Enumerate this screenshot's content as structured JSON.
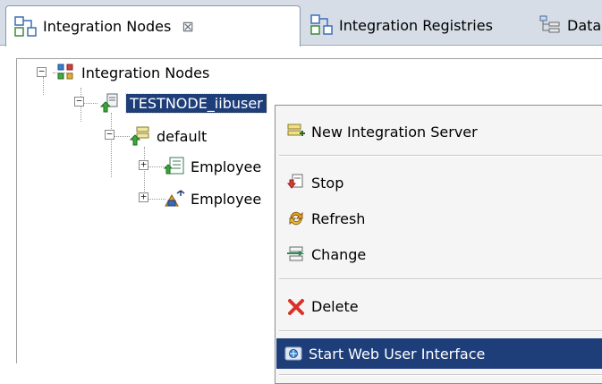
{
  "tabs": [
    {
      "label": "Integration Nodes",
      "close": "⊠",
      "icon": "integration-nodes-icon"
    },
    {
      "label": "Integration Registries",
      "icon": "integration-registries-icon"
    },
    {
      "label": "Data",
      "icon": "data-icon"
    }
  ],
  "tree": {
    "root": {
      "label": "Integration Nodes",
      "expander": "−"
    },
    "node": {
      "label": "TESTNODE_iibuser",
      "expander": "−"
    },
    "server": {
      "label": "default",
      "expander": "−"
    },
    "children": [
      {
        "label": "Employee",
        "expander": "+"
      },
      {
        "label": "Employee",
        "expander": "+"
      }
    ]
  },
  "context_menu": {
    "items": [
      {
        "label": "New Integration Server",
        "icon": "new-server-icon"
      },
      {
        "label": "Stop",
        "icon": "stop-icon"
      },
      {
        "label": "Refresh",
        "icon": "refresh-icon"
      },
      {
        "label": "Change",
        "icon": "change-icon"
      },
      {
        "label": "Delete",
        "icon": "delete-icon"
      },
      {
        "label": "Start Web User Interface",
        "icon": "web-ui-icon",
        "highlighted": true
      }
    ]
  },
  "colors": {
    "selection": "#1e3e7a",
    "tabbar": "#d6dde7",
    "menu_bg": "#f5f5f5",
    "delete_red": "#d9312a",
    "stop_red": "#e03a2f",
    "refresh_orange": "#e8a020",
    "change_green": "#2e8b57"
  }
}
